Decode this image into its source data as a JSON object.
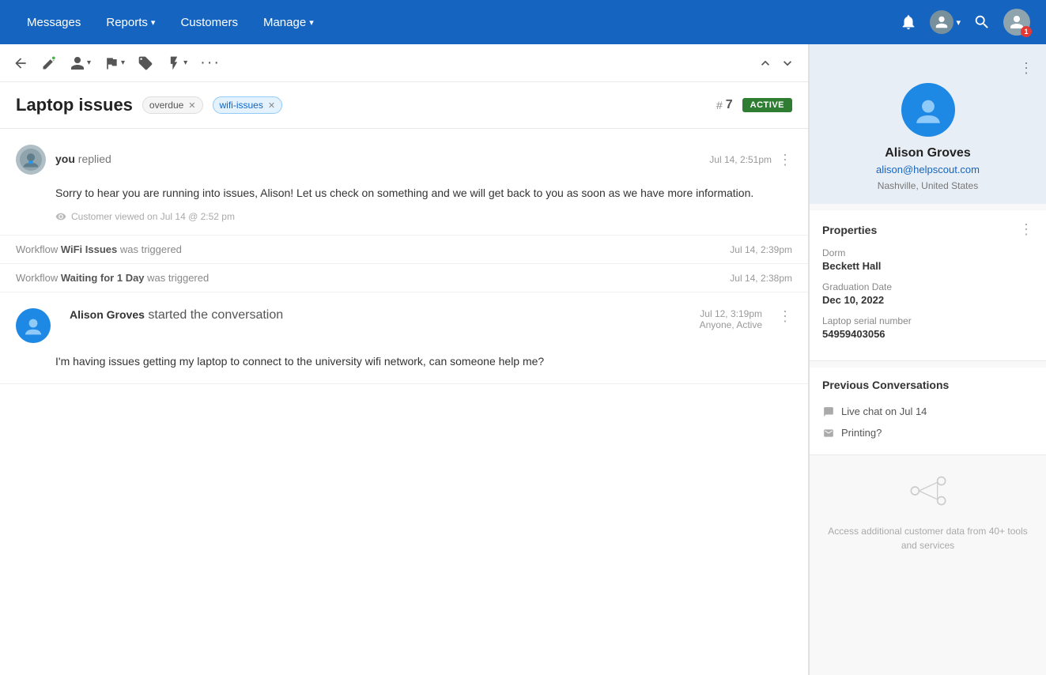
{
  "nav": {
    "messages": "Messages",
    "reports": "Reports",
    "customers": "Customers",
    "manage": "Manage",
    "chevron": "▾"
  },
  "toolbar": {
    "back_icon": "↩",
    "add_icon": "✦",
    "assign_icon": "👤",
    "flag_icon": "⚑",
    "tag_icon": "◈",
    "action_icon": "⚡",
    "more_icon": "···",
    "up_icon": "∧",
    "down_icon": "∨"
  },
  "conversation": {
    "title": "Laptop issues",
    "tag_overdue": "overdue",
    "tag_wifi": "wifi-issues",
    "conv_hash": "#",
    "conv_number": "7",
    "status": "ACTIVE"
  },
  "messages": [
    {
      "sender_you": "you",
      "sender_action": "replied",
      "timestamp": "Jul 14, 2:51pm",
      "body": "Sorry to hear you are running into issues, Alison! Let us check on something and we will get back to you as soon as we have more information.",
      "viewed": "Customer viewed on Jul 14 @ 2:52 pm"
    }
  ],
  "workflow_events": [
    {
      "prefix": "Workflow",
      "name": "WiFi Issues",
      "suffix": "was triggered",
      "timestamp": "Jul 14, 2:39pm"
    },
    {
      "prefix": "Workflow",
      "name": "Waiting for 1 Day",
      "suffix": "was triggered",
      "timestamp": "Jul 14, 2:38pm"
    }
  ],
  "alison_message": {
    "name": "Alison Groves",
    "action": "started the conversation",
    "timestamp": "Jul 12, 3:19pm",
    "status": "Anyone, Active",
    "body": "I'm having issues getting my laptop to connect to the university wifi network, can someone help me?"
  },
  "customer": {
    "name": "Alison Groves",
    "email": "alison@helpscout.com",
    "location": "Nashville, United States"
  },
  "properties": {
    "title": "Properties",
    "dorm_label": "Dorm",
    "dorm_value": "Beckett Hall",
    "graduation_label": "Graduation Date",
    "graduation_value": "Dec 10, 2022",
    "serial_label": "Laptop serial number",
    "serial_value": "54959403056"
  },
  "previous_conversations": {
    "title": "Previous Conversations",
    "items": [
      {
        "icon": "💬",
        "type": "chat",
        "label": "Live chat on Jul 14"
      },
      {
        "icon": "✉",
        "type": "email",
        "label": "Printing?"
      }
    ]
  },
  "integration": {
    "text": "Access additional customer data from 40+ tools and services"
  }
}
